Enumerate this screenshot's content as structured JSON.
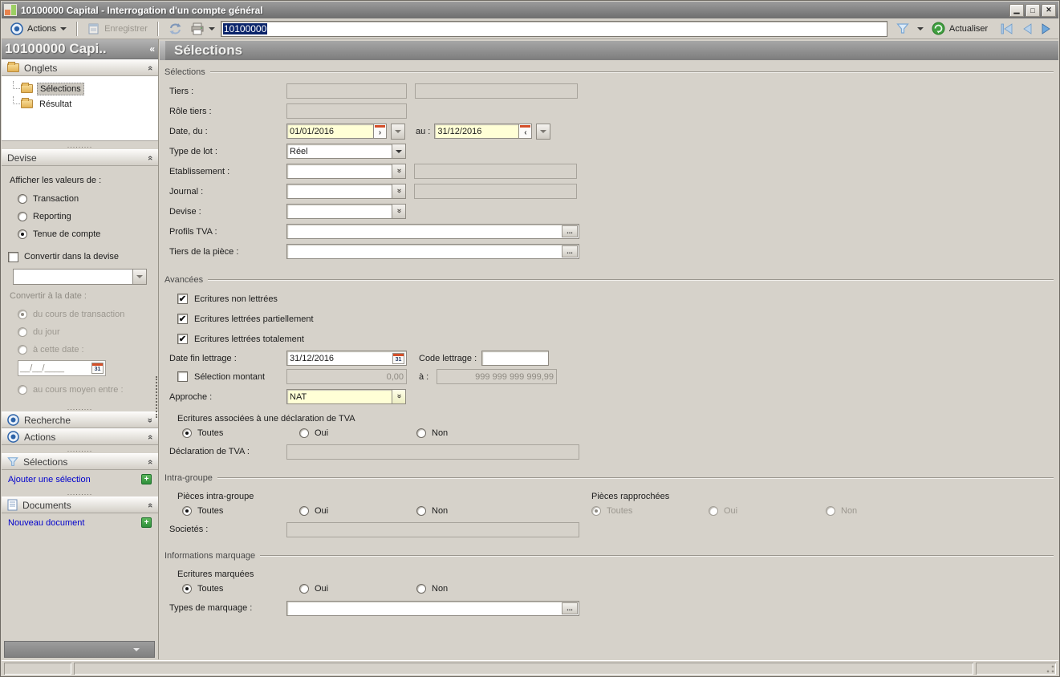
{
  "window": {
    "title": "10100000 Capital -  Interrogation d'un compte général"
  },
  "toolbar": {
    "actions_label": "Actions",
    "save_label": "Enregistrer",
    "account_value": "10100000",
    "refresh_label": "Actualiser"
  },
  "sidebar": {
    "header_title": "10100000 Capi..",
    "onglets_title": "Onglets",
    "tree": [
      {
        "label": "Sélections"
      },
      {
        "label": "Résultat"
      }
    ],
    "devise_title": "Devise",
    "afficher_label": "Afficher les valeurs de :",
    "radio_transaction": "Transaction",
    "radio_reporting": "Reporting",
    "radio_tenue": "Tenue de compte",
    "convert_label": "Convertir dans la devise",
    "convert_date_label": "Convertir à la date :",
    "radio_cours_transaction": "du cours de transaction",
    "radio_du_jour": "du jour",
    "radio_cette_date": "à cette date :",
    "date_placeholder": "__/__/____",
    "radio_cours_moyen": "au cours moyen entre :",
    "recherche_title": "Recherche",
    "actions_title": "Actions",
    "selections_title": "Sélections",
    "add_selection_link": "Ajouter une sélection",
    "documents_title": "Documents",
    "new_document_link": "Nouveau document"
  },
  "main": {
    "page_title": "Sélections",
    "sel": {
      "legend": "Sélections",
      "tiers": "Tiers :",
      "role": "Rôle tiers :",
      "date": "Date, du :",
      "date_from": "01/01/2016",
      "au": "au :",
      "date_to": "31/12/2016",
      "type_lot": "Type de lot :",
      "type_lot_value": "Réel",
      "etab": "Etablissement :",
      "journal": "Journal :",
      "devise": "Devise :",
      "profils": "Profils TVA :",
      "tiers_piece": "Tiers de la pièce :"
    },
    "av": {
      "legend": "Avancées",
      "cb1": "Ecritures non lettrées",
      "cb2": "Ecritures lettrées partiellement",
      "cb3": "Ecritures lettrées totalement",
      "date_fin": "Date fin lettrage :",
      "date_fin_value": "31/12/2016",
      "code": "Code lettrage :",
      "sel_montant": "Sélection montant",
      "montant_from": "0,00",
      "a": "à :",
      "montant_to": "999 999 999 999,99",
      "approche": "Approche :",
      "approche_value": "NAT",
      "tva_label": "Ecritures associées à une déclaration de TVA",
      "r_toutes": "Toutes",
      "r_oui": "Oui",
      "r_non": "Non",
      "decl": "Déclaration de TVA :"
    },
    "ig": {
      "legend": "Intra-groupe",
      "pieces": "Pièces intra-groupe",
      "r_toutes": "Toutes",
      "r_oui": "Oui",
      "r_non": "Non",
      "rapp": "Pièces rapprochées",
      "rr_toutes": "Toutes",
      "rr_oui": "Oui",
      "rr_non": "Non",
      "societes": "Societés :"
    },
    "mq": {
      "legend": "Informations marquage",
      "ecritures": "Ecritures marquées",
      "r_toutes": "Toutes",
      "r_oui": "Oui",
      "r_non": "Non",
      "types": "Types de marquage :"
    }
  },
  "colors": {
    "accent_blue": "#2d63a8",
    "selection_blue": "#0a246a",
    "field_yellow": "#ffffd6",
    "link_blue": "#0000cc",
    "green": "#2f8f3a",
    "orange": "#d4502a",
    "window_gray": "#d6d2ca"
  }
}
